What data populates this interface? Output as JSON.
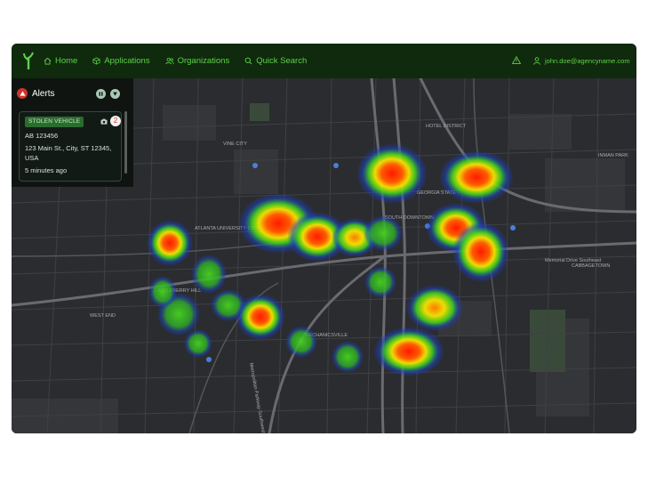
{
  "nav": {
    "home": "Home",
    "applications": "Applications",
    "organizations": "Organizations",
    "quick_search": "Quick Search"
  },
  "user": {
    "email": "john.doe@agencyname.com"
  },
  "alerts": {
    "title": "Alerts",
    "count": "2",
    "card": {
      "tag": "STOLEN VEHICLE",
      "plate": "AB 123456",
      "address_line1": "123 Main St., City, ST 12345,",
      "address_line2": "USA",
      "time": "5 minutes ago"
    }
  },
  "map_labels": [
    "ATLANTA UNIVERSITY CENTER",
    "HOTEL DISTRICT",
    "GEORGIA STATE",
    "SOUTH DOWNTOWN",
    "CABBAGETOWN",
    "INMAN PARK",
    "VINE CITY",
    "WEST END",
    "CASTLEBERRY HILL",
    "MECHANICSVILLE",
    "Memorial Drive Southeast",
    "Metropolitan Parkway Southwest"
  ],
  "colors": {
    "accent": "#5fd14d",
    "topbar": "#0f2a0c",
    "panel": "#0f1411",
    "map_bg": "#2a2b2e",
    "alert_red": "#d0342c",
    "tag_bg": "#2b6b2f"
  }
}
